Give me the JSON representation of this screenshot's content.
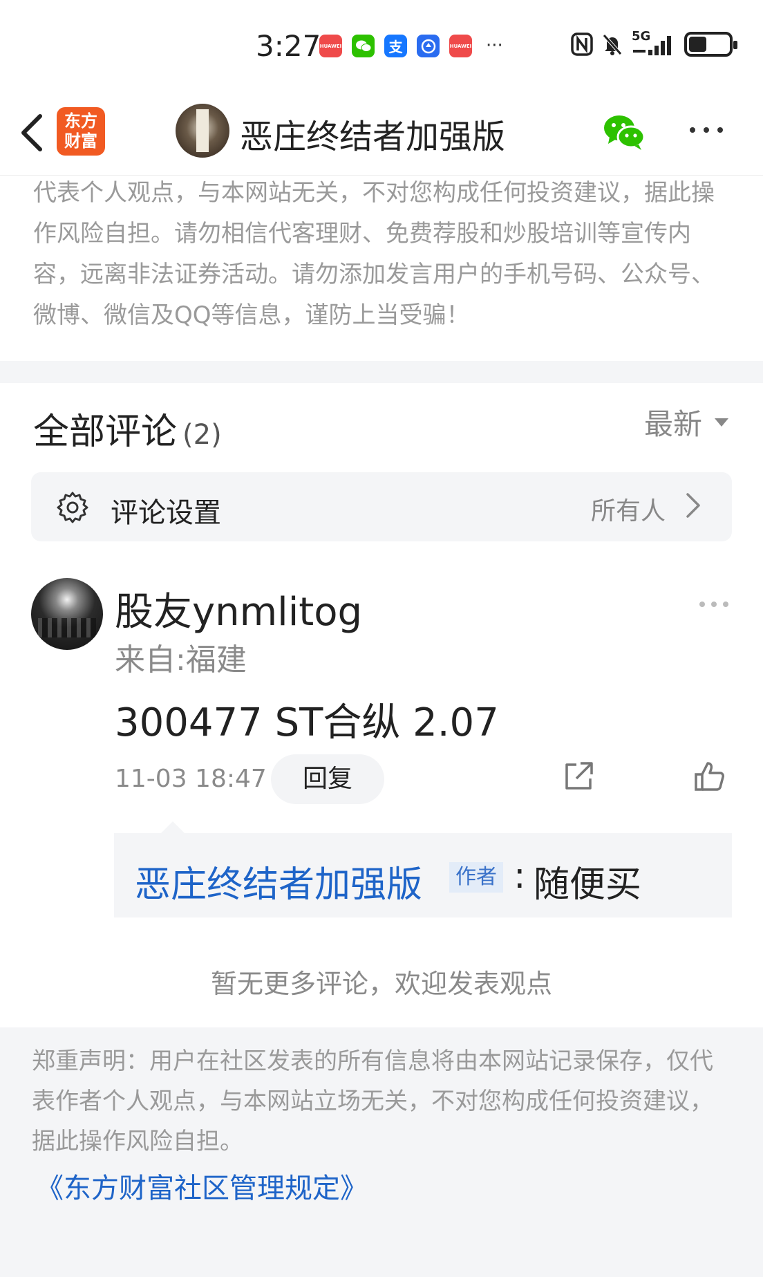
{
  "status_bar": {
    "time": "3:27",
    "apps": [
      {
        "icon": "huawei-appgallery-icon",
        "color": "#ef4a4a",
        "label": "HUAWEI"
      },
      {
        "icon": "wechat-icon",
        "color": "#2dc100",
        "label": ""
      },
      {
        "icon": "alipay-icon",
        "color": "#1677ff",
        "label": "支"
      },
      {
        "icon": "blue-app-icon",
        "color": "#2a6cf0",
        "label": ""
      },
      {
        "icon": "huawei-appgallery-icon",
        "color": "#ef4a4a",
        "label": "HUAWEI"
      }
    ],
    "overflow": "···",
    "network": "5G",
    "battery_level": 0.45
  },
  "nav": {
    "logo_text": "东方\n财富",
    "title": "恶庄终结者加强版",
    "wechat_color": "#2dc100"
  },
  "disclaimer_top": "代表个人观点，与本网站无关，不对您构成任何投资建议，据此操作风险自担。请勿相信代客理财、免费荐股和炒股培训等宣传内容，远离非法证券活动。请勿添加发言用户的手机号码、公众号、微博、微信及QQ等信息，谨防上当受骗！",
  "comments": {
    "title": "全部评论",
    "count": "(2)",
    "sort_label": "最新"
  },
  "settings": {
    "label": "评论设置",
    "value": "所有人"
  },
  "comment": {
    "user": "股友ynmlitog",
    "location": "来自:福建",
    "body": "300477 ST合纵 2.07",
    "time": "11-03 18:47",
    "reply_label": "回复"
  },
  "reply": {
    "author": "恶庄终结者加强版",
    "badge": "作者",
    "colon": ":",
    "text": "随便买"
  },
  "no_more": "暂无更多评论，欢迎发表观点",
  "footer": {
    "text": "郑重声明：用户在社区发表的所有信息将由本网站记录保存，仅代表作者个人观点，与本网站立场无关，不对您构成任何投资建议，据此操作风险自担。",
    "link": "《东方财富社区管理规定》"
  },
  "colors": {
    "accent_blue": "#1e64c8",
    "brand_orange": "#f15a22",
    "muted_gray": "#9a9a9a"
  }
}
